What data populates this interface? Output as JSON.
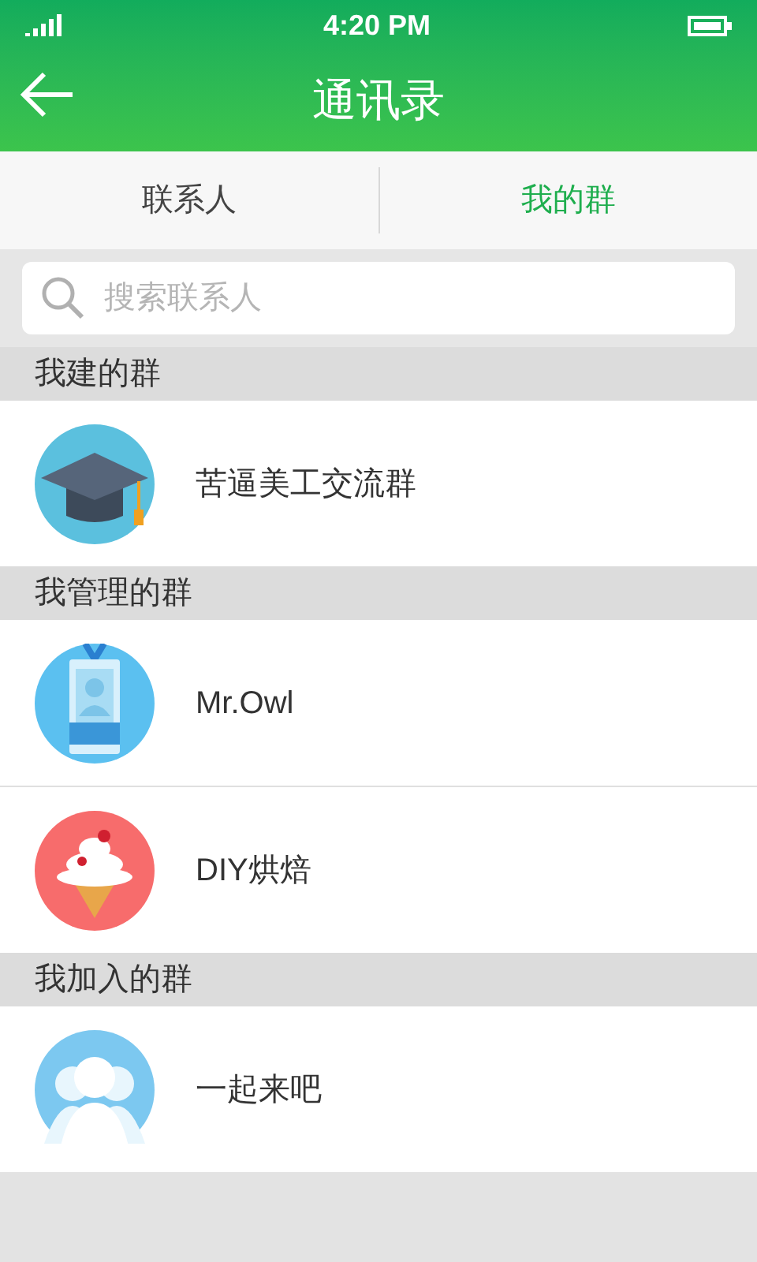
{
  "status_bar": {
    "time": "4:20 PM"
  },
  "header": {
    "title": "通讯录"
  },
  "tabs": [
    {
      "label": "联系人",
      "selected": false
    },
    {
      "label": "我的群",
      "selected": true
    }
  ],
  "search": {
    "placeholder": "搜索联系人"
  },
  "sections": [
    {
      "title": "我建的群",
      "groups": [
        {
          "name": "苦逼美工交流群",
          "kind": "cap"
        }
      ]
    },
    {
      "title": "我管理的群",
      "groups": [
        {
          "name": "Mr.Owl",
          "kind": "badge"
        },
        {
          "name": "DIY烘焙",
          "kind": "icecream"
        }
      ]
    },
    {
      "title": "我加入的群",
      "groups": [
        {
          "name": "一起来吧",
          "kind": "people"
        }
      ]
    }
  ]
}
